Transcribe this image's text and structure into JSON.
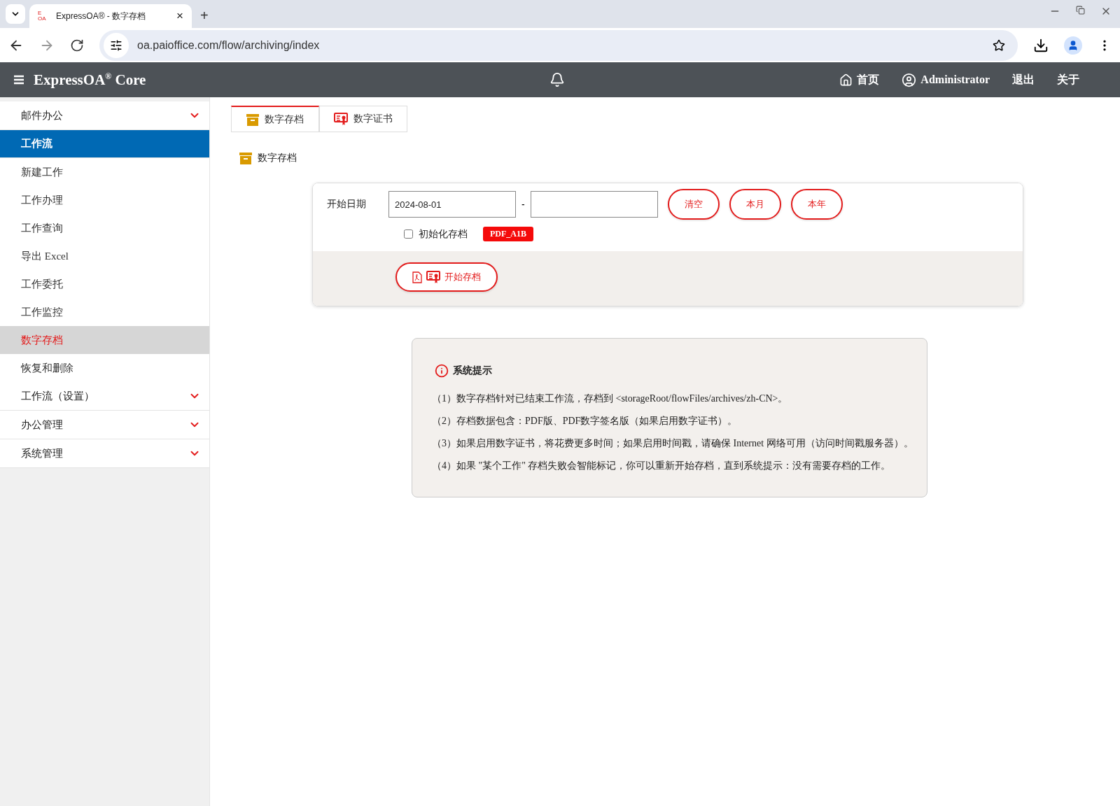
{
  "browser": {
    "tab": {
      "title": "ExpressOA® - 数字存档",
      "favicon_top": "E",
      "favicon_bottom": "OA",
      "close": "×"
    },
    "new_tab": "+",
    "url": "oa.paioffice.com/flow/archiving/index"
  },
  "header": {
    "brand": "ExpressOA",
    "brand_mark": "®",
    "brand_suffix": "Core",
    "nav": [
      {
        "label": "首页",
        "kind": "home"
      },
      {
        "label": "Administrator",
        "kind": "user"
      },
      {
        "label": "退出",
        "kind": "text"
      },
      {
        "label": "关于",
        "kind": "text"
      }
    ]
  },
  "sidebar": {
    "groups": [
      {
        "label": "邮件办公",
        "expanded": false
      },
      {
        "label": "工作流",
        "expanded": true,
        "children": [
          {
            "label": "新建工作",
            "selected": false
          },
          {
            "label": "工作办理",
            "selected": false
          },
          {
            "label": "工作查询",
            "selected": false
          },
          {
            "label": "导出 Excel",
            "selected": false
          },
          {
            "label": "工作委托",
            "selected": false
          },
          {
            "label": "工作监控",
            "selected": false
          },
          {
            "label": "数字存档",
            "selected": true
          },
          {
            "label": "恢复和删除",
            "selected": false
          }
        ]
      },
      {
        "label": "工作流（设置）",
        "expanded": false
      },
      {
        "label": "办公管理",
        "expanded": false
      },
      {
        "label": "系统管理",
        "expanded": false
      }
    ]
  },
  "tabs": [
    {
      "label": "数字存档",
      "kind": "archive",
      "selected": true
    },
    {
      "label": "数字证书",
      "kind": "certificate",
      "selected": false
    }
  ],
  "section_title": "数字存档",
  "form": {
    "date_label": "开始日期",
    "start_date": "2024-08-01",
    "separator": "-",
    "quick_buttons": [
      "清空",
      "本月",
      "本年"
    ],
    "init_checkbox": {
      "label": "初始化存档",
      "checked": false
    },
    "format_badge": "PDF_A1B",
    "start_button": "开始存档"
  },
  "notice": {
    "title": "系统提示",
    "lines": [
      "（1）数字存档针对已结束工作流，存档到 <storageRoot/flowFiles/archives/zh-CN>。",
      "（2）存档数据包含：PDF版、PDF数字签名版（如果启用数字证书）。",
      "（3）如果启用数字证书，将花费更多时间；如果启用时间戳，请确保 Internet 网络可用（访问时间戳服务器）。",
      "（4）如果 \"某个工作\" 存档失败会智能标记，你可以重新开始存档，直到系统提示：没有需要存档的工作。"
    ]
  }
}
